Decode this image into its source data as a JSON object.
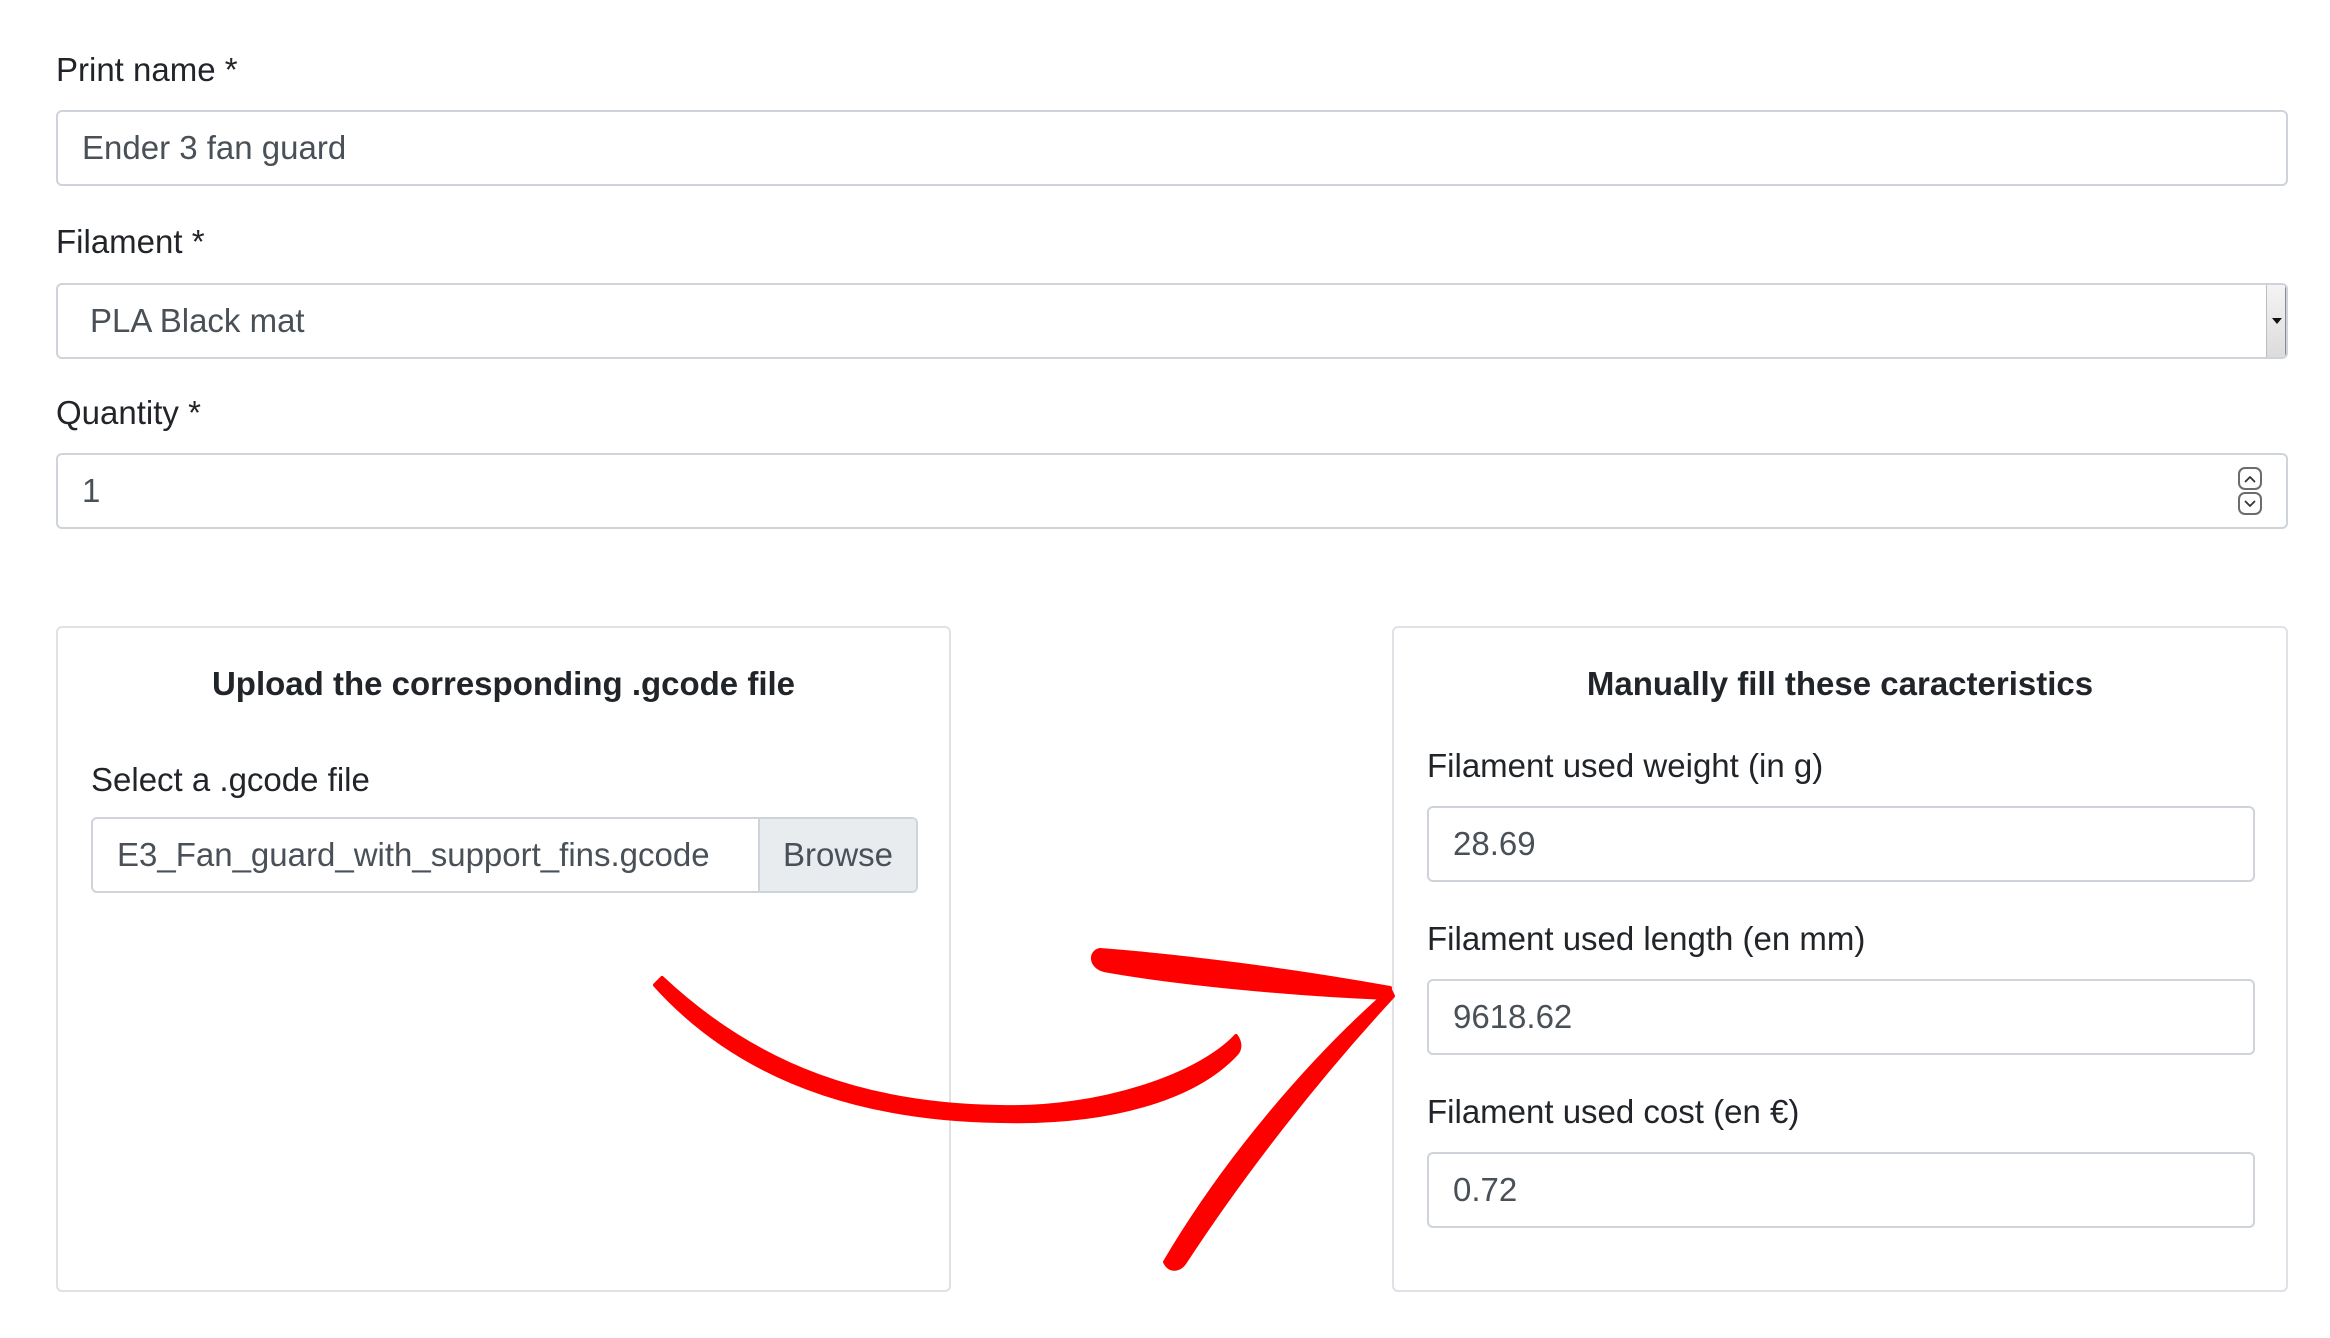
{
  "form": {
    "print_name": {
      "label": "Print name *",
      "value": "Ender 3 fan guard"
    },
    "filament": {
      "label": "Filament *",
      "selected": "PLA Black mat"
    },
    "quantity": {
      "label": "Quantity *",
      "value": "1"
    }
  },
  "upload_card": {
    "title": "Upload the corresponding .gcode file",
    "file_label": "Select a .gcode file",
    "file_name": "E3_Fan_guard_with_support_fins.gcode",
    "browse_label": "Browse"
  },
  "manual_card": {
    "title": "Manually fill these caracteristics",
    "weight": {
      "label": "Filament used weight (in g)",
      "value": "28.69"
    },
    "length": {
      "label": "Filament used length (en mm)",
      "value": "9618.62"
    },
    "cost": {
      "label": "Filament used cost (en €)",
      "value": "0.72"
    }
  },
  "annotation": {
    "arrow_color": "#ff0000"
  },
  "colors": {
    "input_border": "#ced4da",
    "card_border": "#dee2e6",
    "text": "#212529",
    "input_text": "#495057",
    "browse_bg": "#e9ecef"
  }
}
